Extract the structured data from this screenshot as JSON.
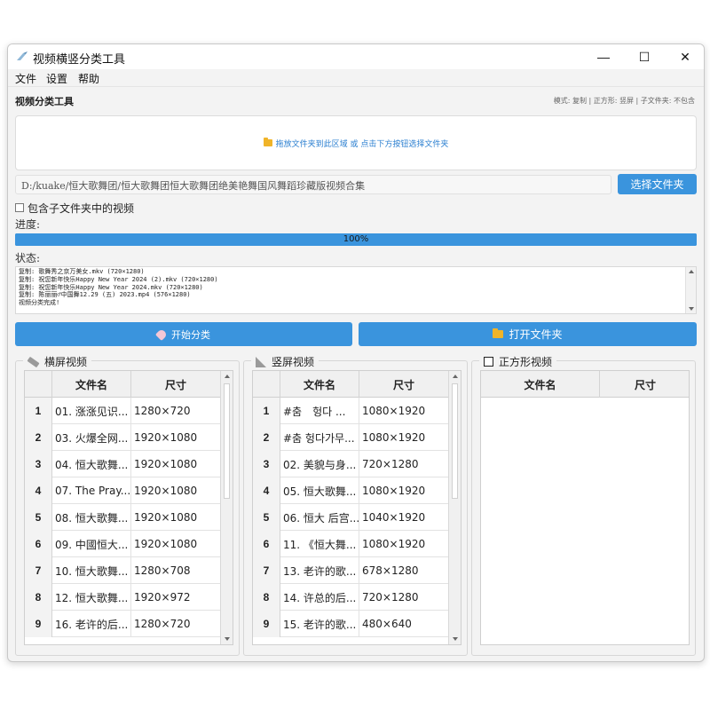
{
  "window": {
    "title": "视频横竖分类工具",
    "controls": {
      "minimize": "—",
      "maximize": "☐",
      "close": "✕"
    }
  },
  "menu": [
    "文件",
    "设置",
    "帮助"
  ],
  "header": {
    "tool_title": "视频分类工具",
    "settings_summary": "模式: 复制 | 正方形: 竖屏 | 子文件夹: 不包含"
  },
  "drop_zone": {
    "text": "拖放文件夹到此区域 或 点击下方按钮选择文件夹",
    "icon": "folder-icon"
  },
  "path": {
    "value": "D:/kuake/恒大歌舞团/恒大歌舞团恒大歌舞团绝美艳舞国风舞蹈珍藏版视频合集",
    "select_button": "选择文件夹"
  },
  "include_subfolders": {
    "label": "包含子文件夹中的视频",
    "checked": false
  },
  "progress": {
    "label": "进度:",
    "value": 100,
    "text": "100%"
  },
  "status": {
    "label": "状态:",
    "lines": [
      "复制: 歌舞秀之京万美女.mkv (720×1280)",
      "复制: 祝您新年快乐Happy New Year 2024 (2).mkv (720×1280)",
      "复制: 祝您新年快乐Happy New Year 2024.mkv (720×1280)",
      "复制: 陈丽丽♂中国舞12.29 (五) 2023.mp4 (576×1280)",
      "视频分类完成!"
    ]
  },
  "actions": {
    "start": "开始分类",
    "open_folder": "打开文件夹"
  },
  "colors": {
    "accent": "#3a94dd",
    "drop_text": "#2b7fd0"
  },
  "groups": [
    {
      "title": "横屏视频",
      "icon": "ruler-icon",
      "columns": [
        "文件名",
        "尺寸"
      ],
      "rows": [
        {
          "n": "1",
          "name": "01. 涨涨见识...",
          "size": "1280×720"
        },
        {
          "n": "2",
          "name": "03. 火爆全网...",
          "size": "1920×1080"
        },
        {
          "n": "3",
          "name": "04. 恒大歌舞...",
          "size": "1920×1080"
        },
        {
          "n": "4",
          "name": "07. The Pray...",
          "size": "1920×1080"
        },
        {
          "n": "5",
          "name": "08. 恒大歌舞...",
          "size": "1920×1080"
        },
        {
          "n": "6",
          "name": "09. 中國恒大...",
          "size": "1920×1080"
        },
        {
          "n": "7",
          "name": "10. 恒大歌舞...",
          "size": "1280×708"
        },
        {
          "n": "8",
          "name": "12. 恒大歌舞...",
          "size": "1920×972"
        },
        {
          "n": "9",
          "name": "16. 老许的后...",
          "size": "1280×720"
        }
      ]
    },
    {
      "title": "竖屏视频",
      "icon": "triangle-ruler-icon",
      "columns": [
        "文件名",
        "尺寸"
      ],
      "rows": [
        {
          "n": "1",
          "name": "#춤　헝다 ...",
          "size": "1080×1920"
        },
        {
          "n": "2",
          "name": "#춤 헝다가무...",
          "size": "1080×1920"
        },
        {
          "n": "3",
          "name": "02. 美貌与身...",
          "size": "720×1280"
        },
        {
          "n": "4",
          "name": "05. 恒大歌舞...",
          "size": "1080×1920"
        },
        {
          "n": "5",
          "name": "06. 恒大 后宫...",
          "size": "1040×1920"
        },
        {
          "n": "6",
          "name": "11. 《恒大舞...",
          "size": "1080×1920"
        },
        {
          "n": "7",
          "name": "13. 老许的歌...",
          "size": "678×1280"
        },
        {
          "n": "8",
          "name": "14. 许总的后...",
          "size": "720×1280"
        },
        {
          "n": "9",
          "name": "15. 老许的歌...",
          "size": "480×640"
        }
      ]
    },
    {
      "title": "正方形视频",
      "icon": "square-icon",
      "columns": [
        "文件名",
        "尺寸"
      ],
      "rows": []
    }
  ]
}
